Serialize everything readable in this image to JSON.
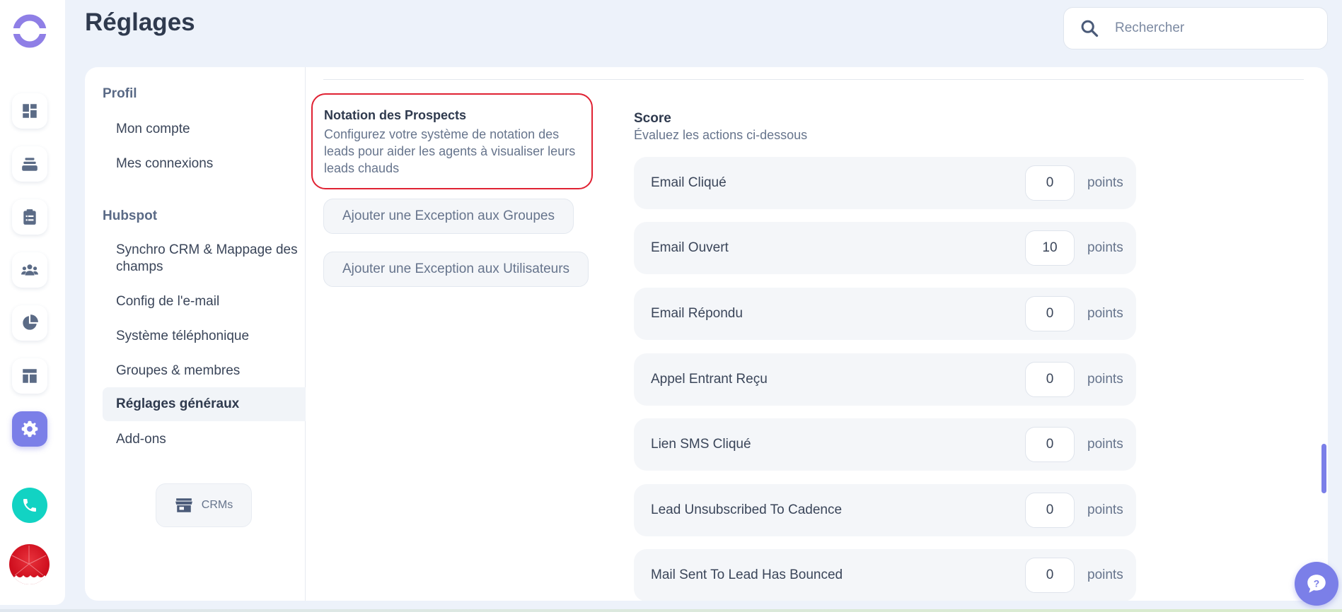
{
  "header": {
    "title": "Réglages",
    "search_placeholder": "Rechercher"
  },
  "rail": {
    "icons": [
      "dashboard-icon",
      "inbox-stack-icon",
      "clipboard-icon",
      "team-icon",
      "pie-chart-icon",
      "layout-icon",
      "settings-icon"
    ],
    "active": "settings-icon",
    "accent": "#7b7fe8",
    "phone_color": "#12d3c3"
  },
  "nav": {
    "group_profile": "Profil",
    "mon_compte": "Mon compte",
    "mes_connexions": "Mes connexions",
    "group_hubspot": "Hubspot",
    "synchro": "Synchro CRM & Mappage des champs",
    "config_email": "Config de l'e-mail",
    "systeme_tel": "Système téléphonique",
    "groupes": "Groupes & membres",
    "reglages_generaux": "Réglages généraux",
    "addons": "Add-ons",
    "crms_button": "CRMs"
  },
  "notation": {
    "title": "Notation des Prospects",
    "description": "Configurez votre système de notation des leads pour aider les agents à visualiser leurs leads chauds",
    "highlight_color": "#e02233"
  },
  "buttons": {
    "exception_groupes": "Ajouter une Exception aux Groupes",
    "exception_utilisateurs": "Ajouter une Exception aux Utilisateurs"
  },
  "score": {
    "title": "Score",
    "subtitle": "Évaluez les actions ci-dessous",
    "unit": "points",
    "rows": [
      {
        "label": "Email Cliqué",
        "value": "0"
      },
      {
        "label": "Email Ouvert",
        "value": "10"
      },
      {
        "label": "Email Répondu",
        "value": "0"
      },
      {
        "label": "Appel Entrant Reçu",
        "value": "0"
      },
      {
        "label": "Lien SMS Cliqué",
        "value": "0"
      },
      {
        "label": "Lead Unsubscribed To Cadence",
        "value": "0"
      },
      {
        "label": "Mail Sent To Lead Has Bounced",
        "value": "0"
      }
    ]
  }
}
